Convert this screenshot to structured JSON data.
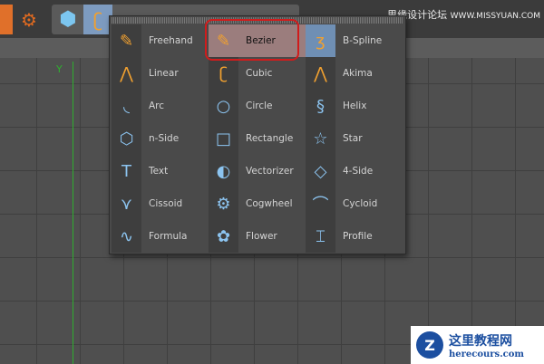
{
  "watermark_top": {
    "cn": "思缘设计论坛",
    "url": "WWW.MISSYUAN.COM"
  },
  "watermark_bottom": {
    "cn": "这里教程网",
    "url": "herecours.com"
  },
  "viewport": {
    "axis_label": "Y"
  },
  "menu": {
    "columns": [
      [
        {
          "label": "Freehand",
          "icon": "✎"
        },
        {
          "label": "Linear",
          "icon": "⋀"
        },
        {
          "label": "Arc",
          "icon": "◟"
        },
        {
          "label": "n-Side",
          "icon": "⬡"
        },
        {
          "label": "Text",
          "icon": "T"
        },
        {
          "label": "Cissoid",
          "icon": "⋎"
        },
        {
          "label": "Formula",
          "icon": "∿"
        }
      ],
      [
        {
          "label": "Bezier",
          "icon": "✎"
        },
        {
          "label": "Cubic",
          "icon": "ʗ"
        },
        {
          "label": "Circle",
          "icon": "○"
        },
        {
          "label": "Rectangle",
          "icon": "□"
        },
        {
          "label": "Vectorizer",
          "icon": "◐"
        },
        {
          "label": "Cogwheel",
          "icon": "⚙"
        },
        {
          "label": "Flower",
          "icon": "✿"
        }
      ],
      [
        {
          "label": "B-Spline",
          "icon": "ʒ"
        },
        {
          "label": "Akima",
          "icon": "⋀"
        },
        {
          "label": "Helix",
          "icon": "§"
        },
        {
          "label": "Star",
          "icon": "☆"
        },
        {
          "label": "4-Side",
          "icon": "◇"
        },
        {
          "label": "Cycloid",
          "icon": "⌒"
        },
        {
          "label": "Profile",
          "icon": "⌶"
        }
      ]
    ]
  },
  "selected": "Bezier"
}
